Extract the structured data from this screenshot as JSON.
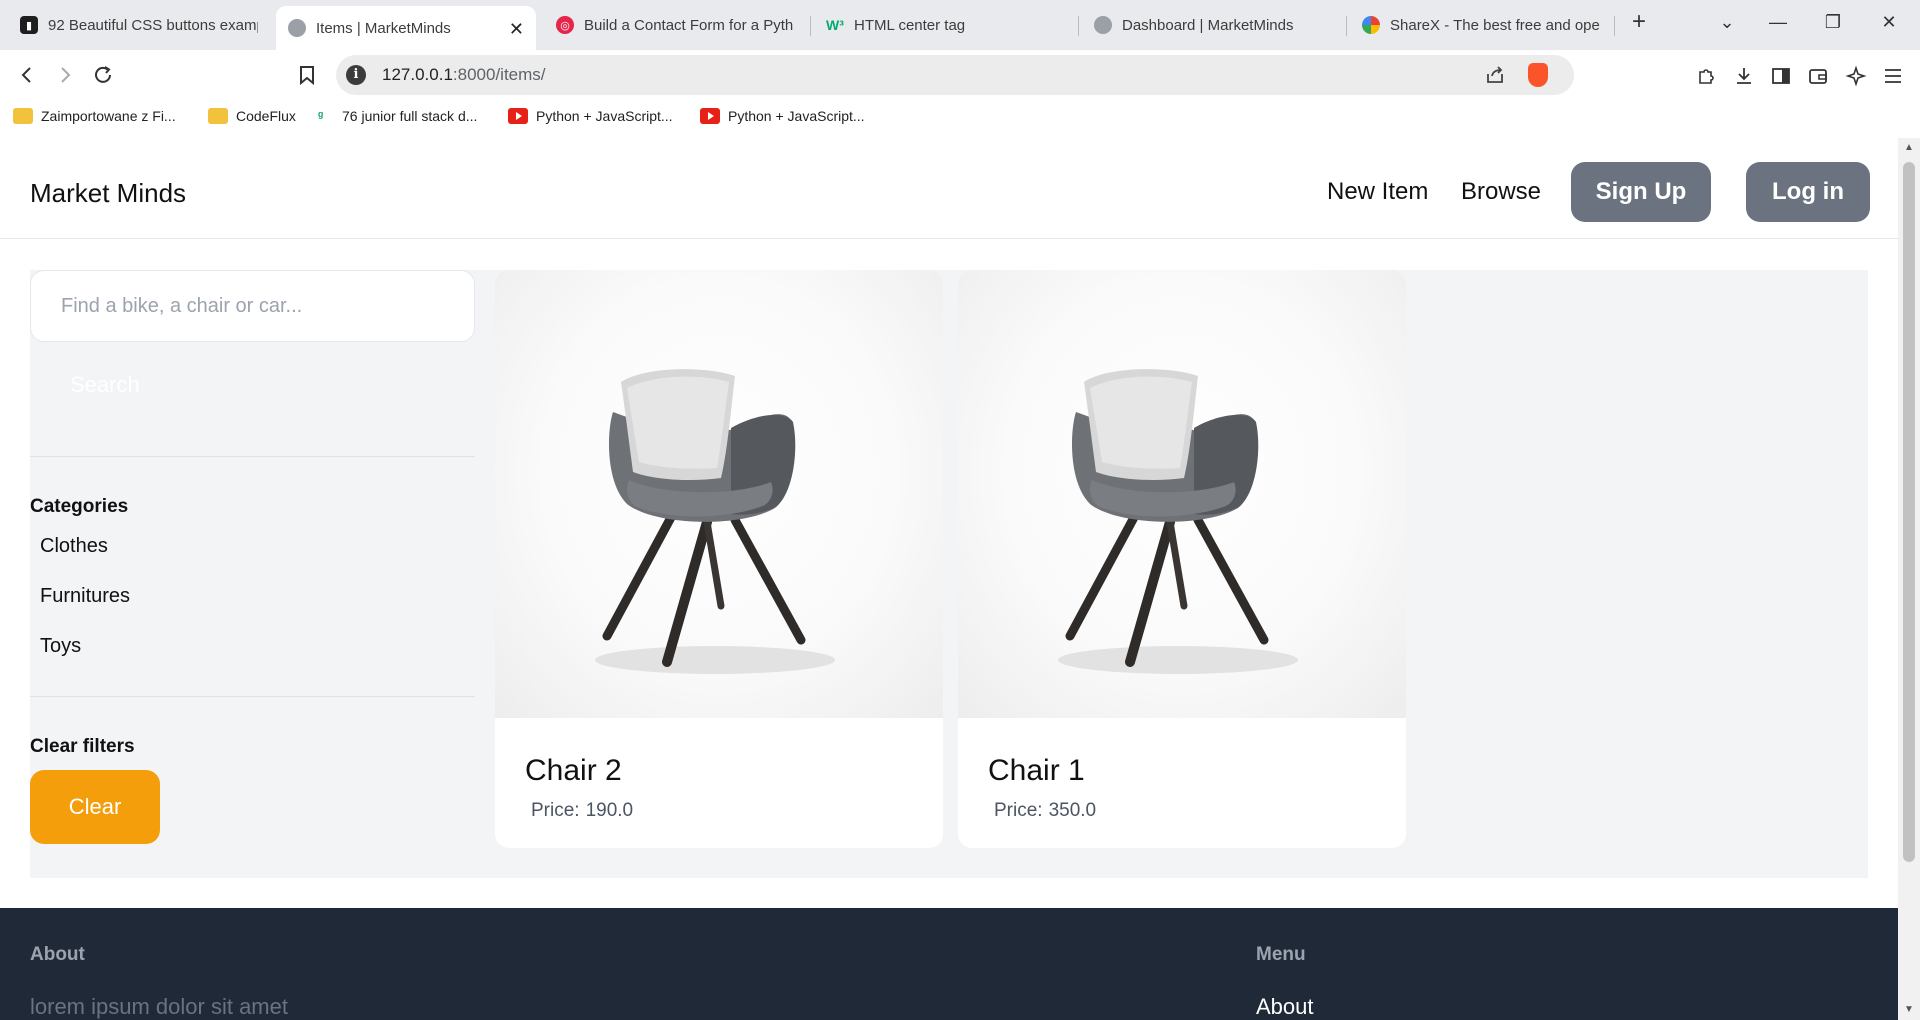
{
  "browser": {
    "tabs": [
      {
        "title": "92 Beautiful CSS buttons examp",
        "icon": "codepen-icon",
        "active": false
      },
      {
        "title": "Items | MarketMinds",
        "icon": "globe-icon",
        "active": true
      },
      {
        "title": "Build a Contact Form for a Pyth",
        "icon": "target-icon",
        "active": false
      },
      {
        "title": "HTML center tag",
        "icon": "w3schools-icon",
        "active": false
      },
      {
        "title": "Dashboard | MarketMinds",
        "icon": "globe-icon",
        "active": false
      },
      {
        "title": "ShareX - The best free and ope",
        "icon": "sharex-icon",
        "active": false
      }
    ],
    "url_host": "127.0.0.1",
    "url_rest": ":8000/items/",
    "bookmarks": [
      {
        "label": "Zaimportowane z Fi...",
        "icon": "folder-icon"
      },
      {
        "label": "CodeFlux",
        "icon": "folder-icon"
      },
      {
        "label": "76 junior full stack d...",
        "icon": "site-icon"
      },
      {
        "label": "Python + JavaScript...",
        "icon": "youtube-icon"
      },
      {
        "label": "Python + JavaScript...",
        "icon": "youtube-icon"
      }
    ]
  },
  "site": {
    "brand": "Market Minds",
    "nav": {
      "new_item": "New Item",
      "browse": "Browse",
      "sign_up": "Sign Up",
      "log_in": "Log in"
    },
    "sidebar": {
      "search_placeholder": "Find a bike, a chair or car...",
      "search_button": "Search",
      "categories_heading": "Categories",
      "categories": [
        "Clothes",
        "Furnitures",
        "Toys"
      ],
      "clear_heading": "Clear filters",
      "clear_button": "Clear"
    },
    "items": [
      {
        "name": "Chair 2",
        "price_label": "Price:",
        "price": "190.0"
      },
      {
        "name": "Chair 1",
        "price_label": "Price:",
        "price": "350.0"
      }
    ],
    "footer": {
      "about_heading": "About",
      "about_text": "lorem ipsum dolor sit amet",
      "menu_heading": "Menu",
      "menu_first": "About"
    }
  },
  "colors": {
    "nav_button": "#6b7280",
    "clear_button": "#f59e0b",
    "footer_bg": "#1f2937",
    "panel_bg": "#f3f4f6"
  }
}
